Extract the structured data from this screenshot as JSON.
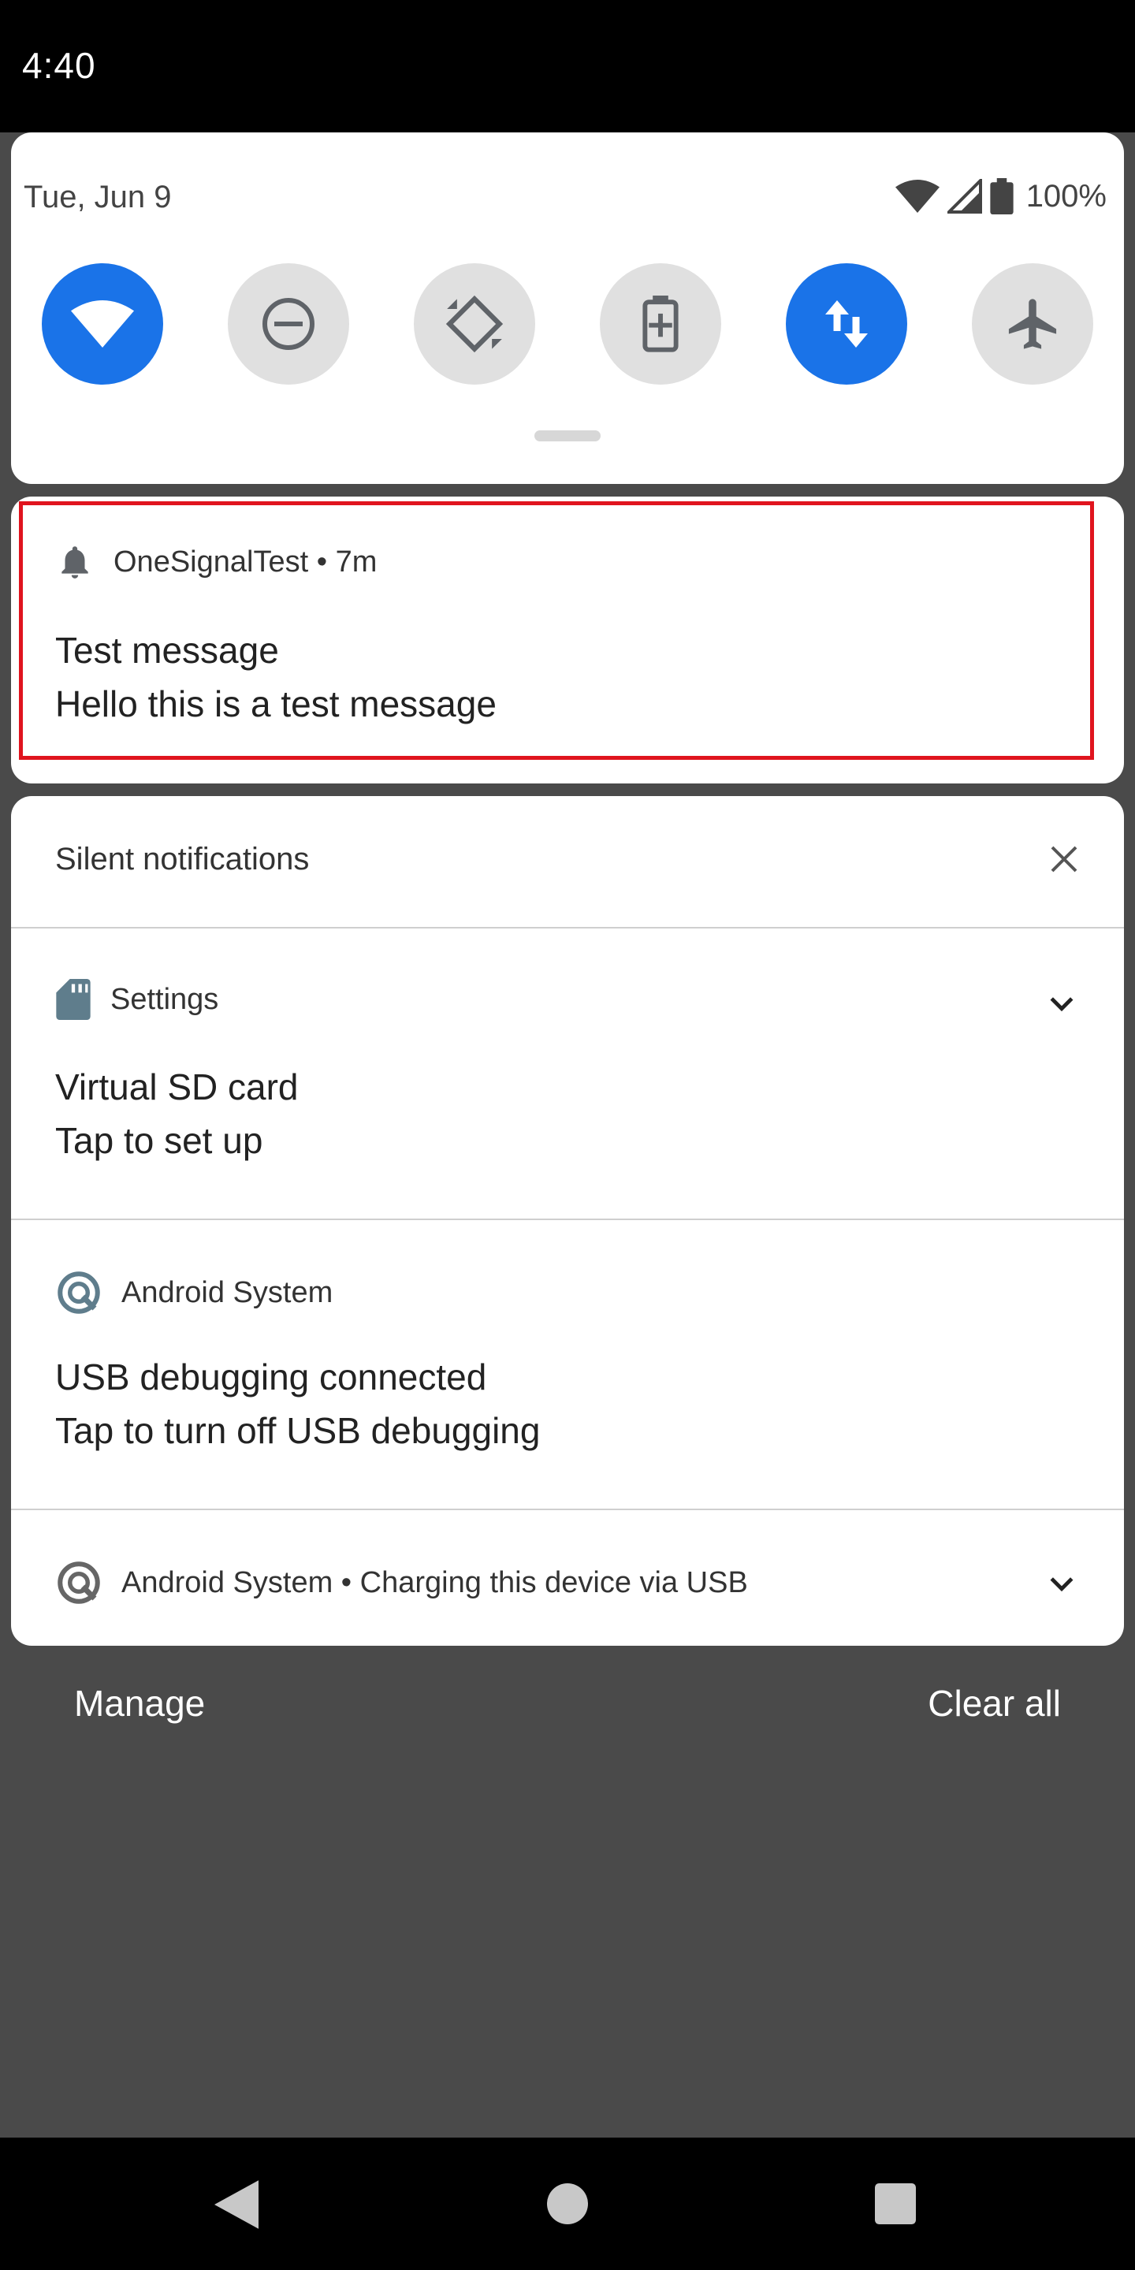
{
  "status_bar": {
    "time": "4:40"
  },
  "quick_settings": {
    "date": "Tue, Jun 9",
    "battery_percent": "100%",
    "tiles": [
      {
        "icon": "wifi-icon",
        "active": true
      },
      {
        "icon": "do-not-disturb-icon",
        "active": false
      },
      {
        "icon": "auto-rotate-icon",
        "active": false
      },
      {
        "icon": "battery-saver-icon",
        "active": false
      },
      {
        "icon": "mobile-data-icon",
        "active": true
      },
      {
        "icon": "airplane-mode-icon",
        "active": false
      }
    ]
  },
  "highlighted_notification": {
    "app_name": "OneSignalTest",
    "time": "7m",
    "title": "Test message",
    "text": "Hello this is a test message"
  },
  "silent": {
    "header": "Silent notifications",
    "items": [
      {
        "app": "Settings",
        "title": "Virtual SD card",
        "text": "Tap to set up"
      },
      {
        "app": "Android System",
        "title": "USB debugging connected",
        "text": "Tap to turn off USB debugging"
      },
      {
        "app": "Android System",
        "summary": "Charging this device via USB"
      }
    ]
  },
  "footer": {
    "manage": "Manage",
    "clear_all": "Clear all"
  },
  "colors": {
    "accent": "#1a73e8",
    "highlight": "#e0141e",
    "scrim": "#4a4a4a"
  }
}
